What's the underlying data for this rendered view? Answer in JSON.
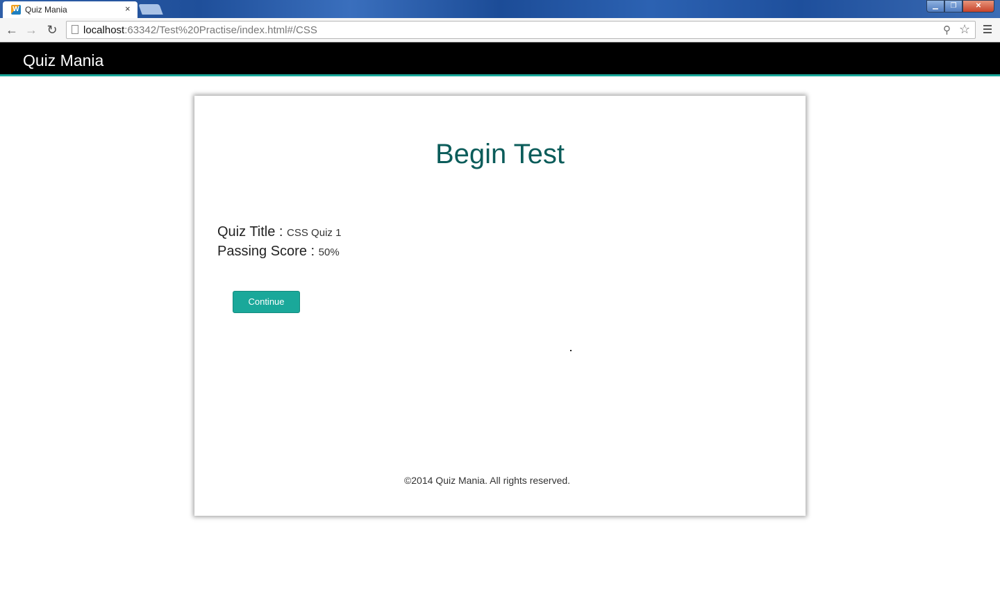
{
  "browser": {
    "tab_title": "Quiz Mania",
    "tab_close": "×",
    "favicon_letter": "W",
    "url_host": "localhost",
    "url_rest": ":63342/Test%20Practise/index.html#/CSS",
    "icons": {
      "back": "back-arrow-icon",
      "forward": "forward-arrow-icon",
      "reload": "reload-icon",
      "zoom": "zoom-icon",
      "star": "bookmark-star-icon",
      "menu": "menu-icon"
    }
  },
  "header": {
    "brand": "Quiz Mania"
  },
  "card": {
    "title": "Begin Test",
    "quiz_title_label": "Quiz Title :",
    "quiz_title_value": "CSS Quiz 1",
    "passing_score_label": "Passing Score :",
    "passing_score_value": "50%",
    "continue_label": "Continue",
    "footer": "©2014 Quiz Mania. All rights reserved."
  },
  "colors": {
    "accent": "#1aa89a",
    "title": "#0b5c5a",
    "header_bg": "#000000"
  }
}
